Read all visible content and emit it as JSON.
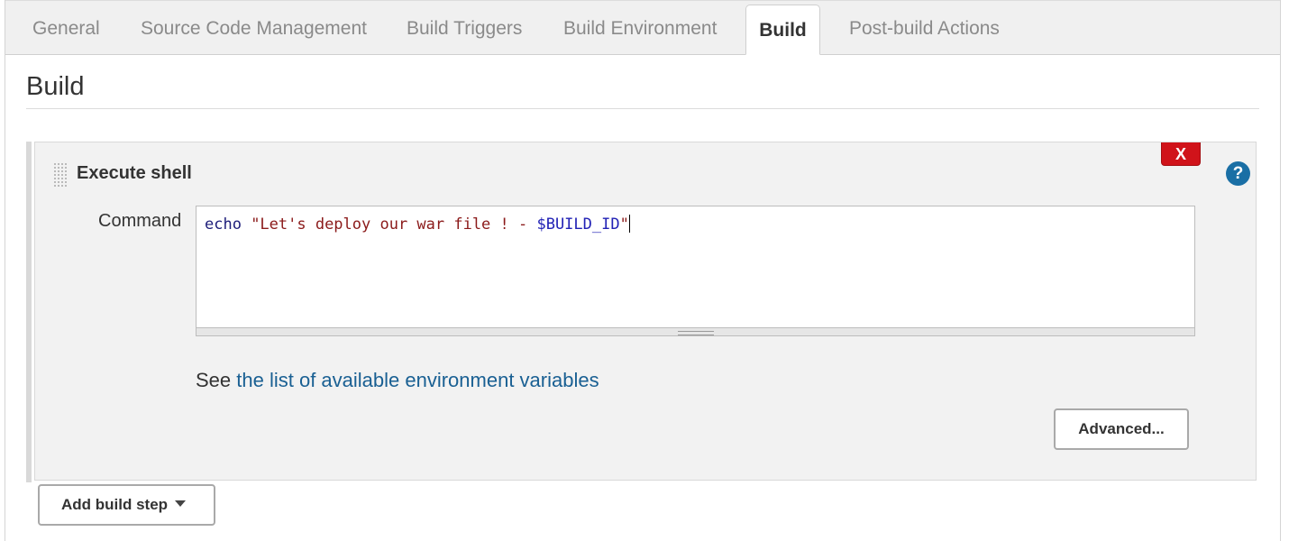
{
  "tabs": [
    {
      "label": "General"
    },
    {
      "label": "Source Code Management"
    },
    {
      "label": "Build Triggers"
    },
    {
      "label": "Build Environment"
    },
    {
      "label": "Build",
      "active": true
    },
    {
      "label": "Post-build Actions"
    }
  ],
  "section": {
    "title": "Build"
  },
  "build_step": {
    "title": "Execute shell",
    "delete_label": "X",
    "help_label": "?",
    "command_label": "Command",
    "command": {
      "keyword": "echo",
      "string_start": " \"Let's deploy our war file ! - ",
      "variable": "$BUILD_ID",
      "string_end": "\""
    },
    "see_prefix": "See ",
    "env_link": "the list of available environment variables",
    "advanced_label": "Advanced..."
  },
  "add_step": {
    "label": "Add build step"
  },
  "icons": {
    "grip": "drag-handle-icon",
    "help": "help-icon",
    "delete": "close-icon",
    "dropdown": "chevron-down-icon"
  },
  "colors": {
    "link": "#1a6093",
    "delete": "#d0131a",
    "help": "#1a6fa5"
  }
}
